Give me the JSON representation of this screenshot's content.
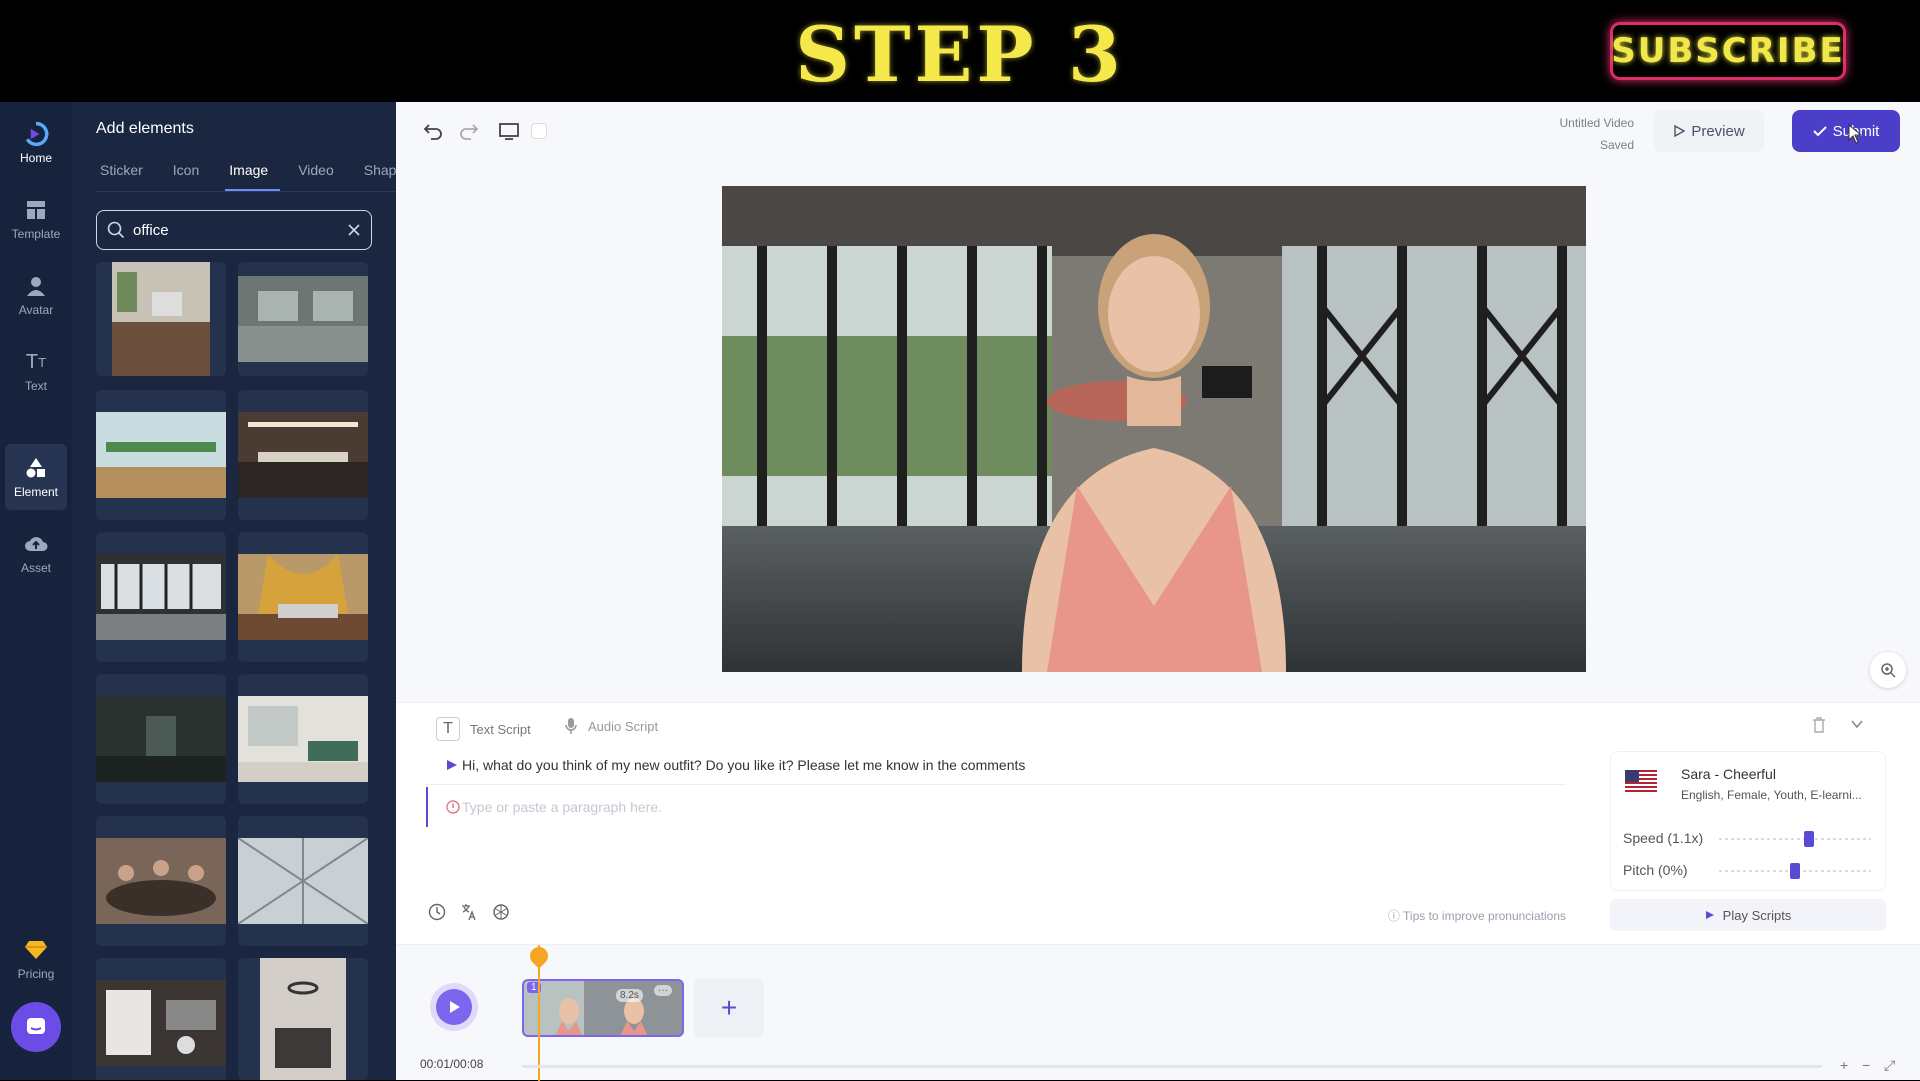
{
  "banner": {
    "step_title": "STEP 3",
    "subscribe_label": "SUBSCRIBE"
  },
  "rail": {
    "items": [
      {
        "label": "Home",
        "icon": "logo-icon"
      },
      {
        "label": "Template",
        "icon": "template-icon"
      },
      {
        "label": "Avatar",
        "icon": "avatar-icon"
      },
      {
        "label": "Text",
        "icon": "text-icon"
      },
      {
        "label": "Element",
        "icon": "shapes-icon",
        "active": true
      },
      {
        "label": "Asset",
        "icon": "cloud-upload-icon"
      },
      {
        "label": "Pricing",
        "icon": "diamond-icon"
      }
    ]
  },
  "panel": {
    "title": "Add elements",
    "tabs": [
      "Sticker",
      "Icon",
      "Image",
      "Video",
      "Shape"
    ],
    "active_tab": "Image",
    "search_value": "office",
    "thumbnails": [
      {
        "name": "office-desk-laptop"
      },
      {
        "name": "office-empty-room"
      },
      {
        "name": "office-open-plan-plants"
      },
      {
        "name": "office-desks-lights"
      },
      {
        "name": "office-glass-windows"
      },
      {
        "name": "office-person-laptop"
      },
      {
        "name": "office-dark-corridor"
      },
      {
        "name": "office-lounge"
      },
      {
        "name": "office-meeting"
      },
      {
        "name": "office-atrium"
      },
      {
        "name": "office-desk-topdown"
      },
      {
        "name": "office-interior-lamp"
      }
    ]
  },
  "editor": {
    "doc_title": "Untitled Video",
    "doc_status": "Saved",
    "preview_label": "Preview",
    "submit_label": "Submit"
  },
  "script": {
    "text_tab": "Text Script",
    "audio_tab": "Audio Script",
    "line1": "Hi, what do you think of my new outfit? Do you like it? Please let me know in the comments",
    "line2_placeholder": "Type or paste a paragraph here.",
    "tips": "Tips to improve pronunciations",
    "voice_name": "Sara - Cheerful",
    "voice_desc": "English, Female, Youth, E-learni...",
    "speed_label": "Speed (1.1x)",
    "pitch_label": "Pitch (0%)",
    "speed_value": 0.6,
    "pitch_value": 0.5,
    "play_scripts": "Play Scripts"
  },
  "timeline": {
    "time": "00:01/00:08",
    "clip_number": "1",
    "clip_duration": "8.2s",
    "zoom_in": "+",
    "zoom_out": "−"
  },
  "colors": {
    "accent": "#4b3ec8",
    "rail_bg": "#17233c",
    "panel_bg": "#1b2740",
    "playhead": "#f5a623",
    "banner_text": "#f4e84a"
  }
}
